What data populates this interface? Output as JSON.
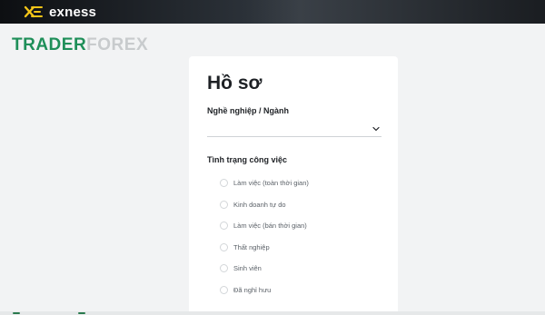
{
  "header": {
    "brand_name": "exness",
    "brand_icon": "exness-logo-icon"
  },
  "watermark": {
    "part1": "TRADER",
    "part2": "FOREX"
  },
  "profile": {
    "title": "Hồ sơ",
    "occupation": {
      "label": "Nghề nghiệp / Ngành",
      "value": "",
      "icon": "chevron-down-icon"
    },
    "employment_status": {
      "label": "Tình trạng công việc",
      "options": [
        "Làm việc (toàn thời gian)",
        "Kinh doanh tự do",
        "Làm việc (bán thời gian)",
        "Thất nghiệp",
        "Sinh viên",
        "Đã nghỉ hưu"
      ]
    }
  },
  "colors": {
    "header_bg": "#1f2328",
    "brand_accent": "#f5c518",
    "watermark_green": "#1f8f59",
    "watermark_gray": "#c8cbcd",
    "page_bg": "#f2f3f4",
    "card_bg": "#ffffff"
  }
}
